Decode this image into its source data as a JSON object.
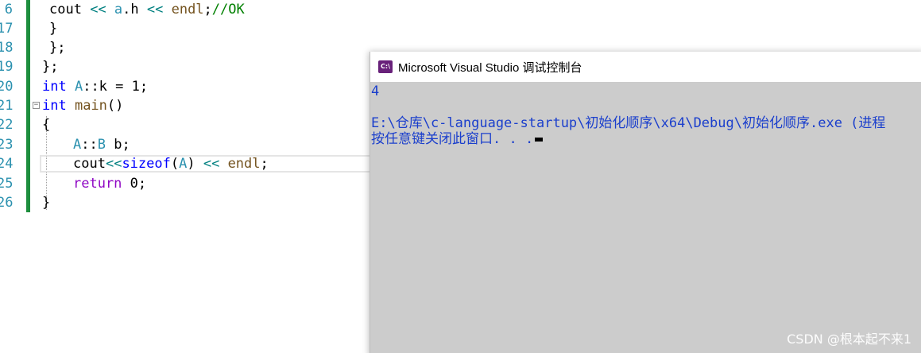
{
  "editor": {
    "lines": [
      {
        "num": "6",
        "tokens": [
          {
            "t": "text",
            "v": "cout "
          },
          {
            "t": "op",
            "v": "<< "
          },
          {
            "t": "type",
            "v": "a"
          },
          {
            "t": "text",
            "v": ".h "
          },
          {
            "t": "op",
            "v": "<< "
          },
          {
            "t": "fn",
            "v": "endl"
          },
          {
            "t": "text",
            "v": ";"
          },
          {
            "t": "cmt",
            "v": "//OK"
          }
        ]
      },
      {
        "num": "17",
        "tokens": [
          {
            "t": "text",
            "v": "}"
          }
        ]
      },
      {
        "num": "18",
        "tokens": [
          {
            "t": "text",
            "v": "};"
          }
        ]
      },
      {
        "num": "19",
        "tokens": [
          {
            "t": "text",
            "v": "};"
          }
        ]
      },
      {
        "num": "20",
        "tokens": [
          {
            "t": "kw",
            "v": "int "
          },
          {
            "t": "type",
            "v": "A"
          },
          {
            "t": "text",
            "v": "::k = 1;"
          }
        ]
      },
      {
        "num": "21",
        "tokens": [
          {
            "t": "kw",
            "v": "int "
          },
          {
            "t": "fn",
            "v": "main"
          },
          {
            "t": "text",
            "v": "()"
          }
        ]
      },
      {
        "num": "22",
        "tokens": [
          {
            "t": "text",
            "v": "{"
          }
        ]
      },
      {
        "num": "23",
        "tokens": [
          {
            "t": "type",
            "v": "A"
          },
          {
            "t": "text",
            "v": "::"
          },
          {
            "t": "type",
            "v": "B"
          },
          {
            "t": "text",
            "v": " b;"
          }
        ]
      },
      {
        "num": "24",
        "tokens": [
          {
            "t": "text",
            "v": "cout"
          },
          {
            "t": "op",
            "v": "<<"
          },
          {
            "t": "kw",
            "v": "sizeof"
          },
          {
            "t": "text",
            "v": "("
          },
          {
            "t": "type",
            "v": "A"
          },
          {
            "t": "text",
            "v": ") "
          },
          {
            "t": "op",
            "v": "<< "
          },
          {
            "t": "fn",
            "v": "endl"
          },
          {
            "t": "text",
            "v": ";"
          }
        ]
      },
      {
        "num": "25",
        "tokens": [
          {
            "t": "kw2",
            "v": "return "
          },
          {
            "t": "text",
            "v": "0;"
          }
        ]
      },
      {
        "num": "26",
        "tokens": [
          {
            "t": "text",
            "v": "}"
          }
        ]
      }
    ]
  },
  "console": {
    "title": "Microsoft Visual Studio 调试控制台",
    "icon_label": "C:\\",
    "output_line1": "4",
    "output_line2": "E:\\仓库\\c-language-startup\\初始化顺序\\x64\\Debug\\初始化顺序.exe (进程 ",
    "output_line3": "按任意键关闭此窗口. . ."
  },
  "watermark": "CSDN @根本起不来1"
}
